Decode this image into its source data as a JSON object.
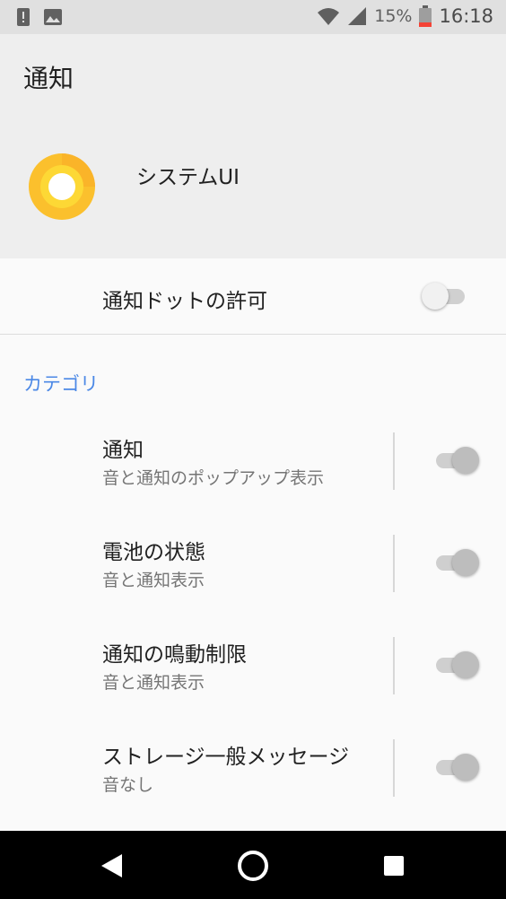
{
  "status_bar": {
    "battery_percent": "15%",
    "time": "16:18",
    "icons": [
      "alert-icon",
      "image-icon",
      "wifi-icon",
      "signal-icon",
      "battery-icon"
    ]
  },
  "header": {
    "title": "通知",
    "app_name": "システムUI",
    "app_icon": "system-ui-icon"
  },
  "notification_dot": {
    "label": "通知ドットの許可",
    "enabled": false
  },
  "category_header": "カテゴリ",
  "categories": [
    {
      "title": "通知",
      "subtitle": "音と通知のポップアップ表示",
      "enabled": true
    },
    {
      "title": "電池の状態",
      "subtitle": "音と通知表示",
      "enabled": true
    },
    {
      "title": "通知の鳴動制限",
      "subtitle": "音と通知表示",
      "enabled": true
    },
    {
      "title": "ストレージ一般メッセージ",
      "subtitle": "音なし",
      "enabled": true
    }
  ],
  "nav_bar": {
    "icons": [
      "back-icon",
      "home-icon",
      "recents-icon"
    ]
  },
  "colors": {
    "accent": "#4b88e6",
    "header_bg": "#eeeeee",
    "status_bar_bg": "#e0e0e0",
    "battery_low": "#f44336"
  }
}
